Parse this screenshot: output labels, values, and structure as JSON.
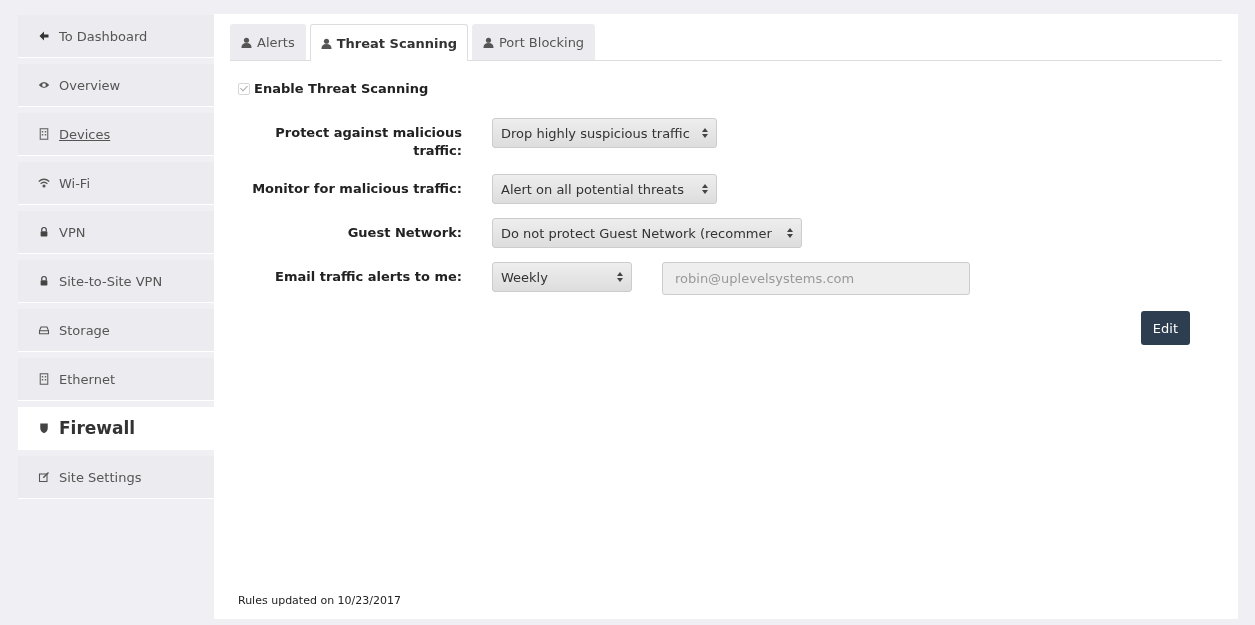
{
  "sidebar": {
    "items": [
      {
        "label": "To Dashboard",
        "kind": "arrow",
        "selected": false,
        "underlined": false
      },
      {
        "label": "Overview",
        "kind": "eye",
        "selected": false,
        "underlined": false
      },
      {
        "label": "Devices",
        "kind": "building",
        "selected": false,
        "underlined": true
      },
      {
        "label": "Wi-Fi",
        "kind": "wifi",
        "selected": false,
        "underlined": false
      },
      {
        "label": "VPN",
        "kind": "lock",
        "selected": false,
        "underlined": false
      },
      {
        "label": "Site-to-Site VPN",
        "kind": "lock",
        "selected": false,
        "underlined": false
      },
      {
        "label": "Storage",
        "kind": "drive",
        "selected": false,
        "underlined": false
      },
      {
        "label": "Ethernet",
        "kind": "building",
        "selected": false,
        "underlined": false
      },
      {
        "label": "Firewall",
        "kind": "shield",
        "selected": true,
        "underlined": false
      },
      {
        "label": "Site Settings",
        "kind": "edit",
        "selected": false,
        "underlined": false
      }
    ]
  },
  "tabs": [
    {
      "label": "Alerts",
      "selected": false
    },
    {
      "label": "Threat Scanning",
      "selected": true
    },
    {
      "label": "Port Blocking",
      "selected": false
    }
  ],
  "enable": {
    "label": "Enable Threat Scanning",
    "checked": true,
    "disabled": true
  },
  "fields": [
    {
      "label": "Protect against malicious traffic:",
      "select": "Drop highly suspicious traffic"
    },
    {
      "label": "Monitor for malicious traffic:",
      "select": "Alert on all potential threats"
    },
    {
      "label": "Guest Network:",
      "select": "Do not protect Guest Network (recommer"
    },
    {
      "label": "Email traffic alerts to me:",
      "select": "Weekly",
      "email": {
        "value": "robin@uplevelsystems.com",
        "disabled": true
      }
    }
  ],
  "edit_button": "Edit",
  "footer": "Rules updated on 10/23/2017"
}
